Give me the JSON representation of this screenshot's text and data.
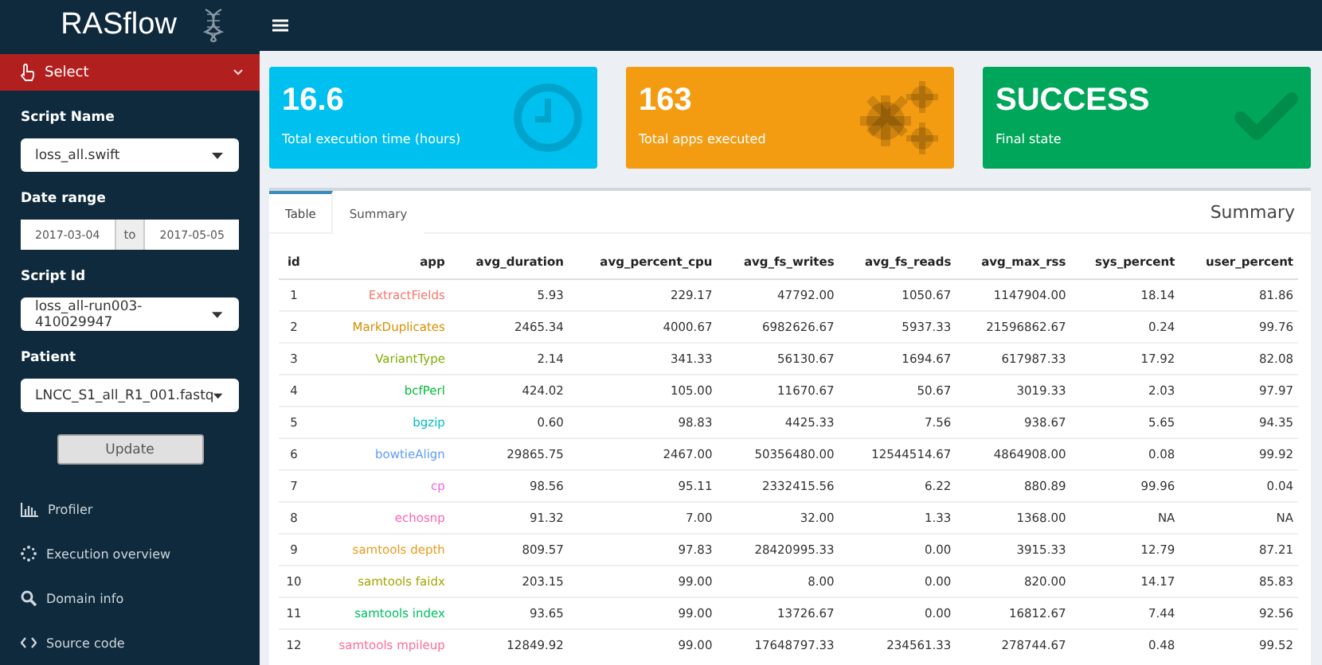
{
  "header": {
    "logo": "RASflow"
  },
  "sidebar": {
    "select_header": "Select",
    "fields": [
      {
        "kind": "select",
        "label": "Script Name",
        "value": "loss_all.swift"
      },
      {
        "kind": "daterange",
        "label": "Date range",
        "start": "2017-03-04",
        "separator": "to",
        "end": "2017-05-05"
      },
      {
        "kind": "select",
        "label": "Script Id",
        "value": "loss_all-run003-410029947"
      },
      {
        "kind": "select",
        "label": "Patient",
        "value": "LNCC_S1_all_R1_001.fastq"
      }
    ],
    "button": "Update",
    "menu": [
      {
        "kind": "chart",
        "label": "Profiler"
      },
      {
        "kind": "spinner",
        "label": "Execution overview"
      },
      {
        "kind": "search",
        "label": "Domain info"
      },
      {
        "kind": "code",
        "label": "Source code"
      }
    ]
  },
  "info_boxes": [
    {
      "kind": "clock",
      "value": "16.6",
      "label": "Total execution time (hours)",
      "color": "#00c0ef"
    },
    {
      "kind": "gears",
      "value": "163",
      "label": "Total apps executed",
      "color": "#f39c12"
    },
    {
      "kind": "check",
      "value": "SUCCESS",
      "label": "Final state",
      "color": "#00a65a"
    }
  ],
  "tabs": [
    {
      "label": "Table",
      "selected": true
    },
    {
      "label": "Summary",
      "selected": false
    }
  ],
  "box_title": "Summary",
  "table": {
    "columns": [
      "id",
      "app",
      "avg_duration",
      "avg_percent_cpu",
      "avg_fs_writes",
      "avg_fs_reads",
      "avg_max_rss",
      "sys_percent",
      "user_percent"
    ],
    "rows": [
      {
        "color": "#f8766d",
        "cells": [
          "1",
          "ExtractFields",
          "5.93",
          "229.17",
          "47792.00",
          "1050.67",
          "1147904.00",
          "18.14",
          "81.86"
        ]
      },
      {
        "color": "#d89000",
        "cells": [
          "2",
          "MarkDuplicates",
          "2465.34",
          "4000.67",
          "6982626.67",
          "5937.33",
          "21596862.67",
          "0.24",
          "99.76"
        ]
      },
      {
        "color": "#7cae00",
        "cells": [
          "3",
          "VariantType",
          "2.14",
          "341.33",
          "56130.67",
          "1694.67",
          "617987.33",
          "17.92",
          "82.08"
        ]
      },
      {
        "color": "#00ba38",
        "cells": [
          "4",
          "bcfPerl",
          "424.02",
          "105.00",
          "11670.67",
          "50.67",
          "3019.33",
          "2.03",
          "97.97"
        ]
      },
      {
        "color": "#00bfc4",
        "cells": [
          "5",
          "bgzip",
          "0.60",
          "98.83",
          "4425.33",
          "7.56",
          "938.67",
          "5.65",
          "94.35"
        ]
      },
      {
        "color": "#619cff",
        "cells": [
          "6",
          "bowtieAlign",
          "29865.75",
          "2467.00",
          "50356480.00",
          "12544514.67",
          "4864908.00",
          "0.08",
          "99.92"
        ]
      },
      {
        "color": "#f564e3",
        "cells": [
          "7",
          "cp",
          "98.56",
          "95.11",
          "2332415.56",
          "6.22",
          "880.89",
          "99.96",
          "0.04"
        ]
      },
      {
        "color": "#ff64b0",
        "cells": [
          "8",
          "echosnp",
          "91.32",
          "7.00",
          "32.00",
          "1.33",
          "1368.00",
          "NA",
          "NA"
        ]
      },
      {
        "color": "#e89b1c",
        "cells": [
          "9",
          "samtools depth",
          "809.57",
          "97.83",
          "28420995.33",
          "0.00",
          "3915.33",
          "12.79",
          "87.21"
        ]
      },
      {
        "color": "#a3a500",
        "cells": [
          "10",
          "samtools faidx",
          "203.15",
          "99.00",
          "8.00",
          "0.00",
          "820.00",
          "14.17",
          "85.83"
        ]
      },
      {
        "color": "#00c060",
        "cells": [
          "11",
          "samtools index",
          "93.65",
          "99.00",
          "13726.67",
          "0.00",
          "16812.67",
          "7.44",
          "92.56"
        ]
      },
      {
        "color": "#ff6c91",
        "cells": [
          "12",
          "samtools mpileup",
          "12849.92",
          "99.00",
          "17648797.33",
          "234561.33",
          "278744.67",
          "0.48",
          "99.52"
        ]
      }
    ]
  }
}
